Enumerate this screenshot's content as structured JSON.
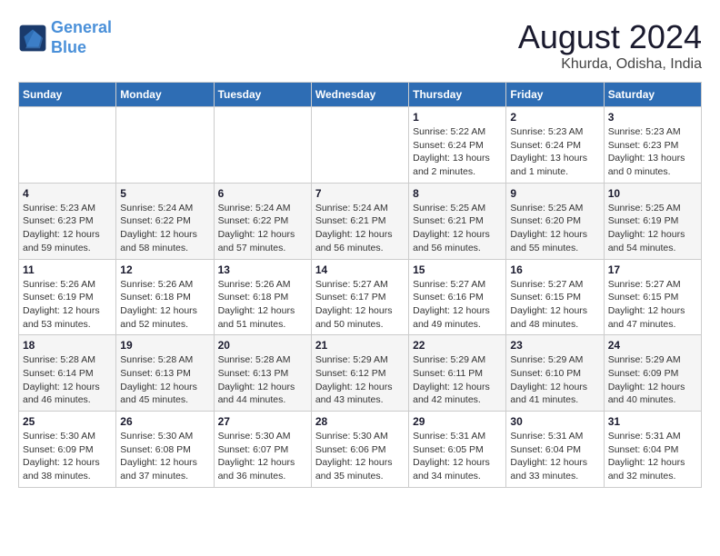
{
  "logo": {
    "line1": "General",
    "line2": "Blue"
  },
  "title": "August 2024",
  "subtitle": "Khurda, Odisha, India",
  "days_of_week": [
    "Sunday",
    "Monday",
    "Tuesday",
    "Wednesday",
    "Thursday",
    "Friday",
    "Saturday"
  ],
  "weeks": [
    [
      {
        "day": "",
        "info": ""
      },
      {
        "day": "",
        "info": ""
      },
      {
        "day": "",
        "info": ""
      },
      {
        "day": "",
        "info": ""
      },
      {
        "day": "1",
        "info": "Sunrise: 5:22 AM\nSunset: 6:24 PM\nDaylight: 13 hours\nand 2 minutes."
      },
      {
        "day": "2",
        "info": "Sunrise: 5:23 AM\nSunset: 6:24 PM\nDaylight: 13 hours\nand 1 minute."
      },
      {
        "day": "3",
        "info": "Sunrise: 5:23 AM\nSunset: 6:23 PM\nDaylight: 13 hours\nand 0 minutes."
      }
    ],
    [
      {
        "day": "4",
        "info": "Sunrise: 5:23 AM\nSunset: 6:23 PM\nDaylight: 12 hours\nand 59 minutes."
      },
      {
        "day": "5",
        "info": "Sunrise: 5:24 AM\nSunset: 6:22 PM\nDaylight: 12 hours\nand 58 minutes."
      },
      {
        "day": "6",
        "info": "Sunrise: 5:24 AM\nSunset: 6:22 PM\nDaylight: 12 hours\nand 57 minutes."
      },
      {
        "day": "7",
        "info": "Sunrise: 5:24 AM\nSunset: 6:21 PM\nDaylight: 12 hours\nand 56 minutes."
      },
      {
        "day": "8",
        "info": "Sunrise: 5:25 AM\nSunset: 6:21 PM\nDaylight: 12 hours\nand 56 minutes."
      },
      {
        "day": "9",
        "info": "Sunrise: 5:25 AM\nSunset: 6:20 PM\nDaylight: 12 hours\nand 55 minutes."
      },
      {
        "day": "10",
        "info": "Sunrise: 5:25 AM\nSunset: 6:19 PM\nDaylight: 12 hours\nand 54 minutes."
      }
    ],
    [
      {
        "day": "11",
        "info": "Sunrise: 5:26 AM\nSunset: 6:19 PM\nDaylight: 12 hours\nand 53 minutes."
      },
      {
        "day": "12",
        "info": "Sunrise: 5:26 AM\nSunset: 6:18 PM\nDaylight: 12 hours\nand 52 minutes."
      },
      {
        "day": "13",
        "info": "Sunrise: 5:26 AM\nSunset: 6:18 PM\nDaylight: 12 hours\nand 51 minutes."
      },
      {
        "day": "14",
        "info": "Sunrise: 5:27 AM\nSunset: 6:17 PM\nDaylight: 12 hours\nand 50 minutes."
      },
      {
        "day": "15",
        "info": "Sunrise: 5:27 AM\nSunset: 6:16 PM\nDaylight: 12 hours\nand 49 minutes."
      },
      {
        "day": "16",
        "info": "Sunrise: 5:27 AM\nSunset: 6:15 PM\nDaylight: 12 hours\nand 48 minutes."
      },
      {
        "day": "17",
        "info": "Sunrise: 5:27 AM\nSunset: 6:15 PM\nDaylight: 12 hours\nand 47 minutes."
      }
    ],
    [
      {
        "day": "18",
        "info": "Sunrise: 5:28 AM\nSunset: 6:14 PM\nDaylight: 12 hours\nand 46 minutes."
      },
      {
        "day": "19",
        "info": "Sunrise: 5:28 AM\nSunset: 6:13 PM\nDaylight: 12 hours\nand 45 minutes."
      },
      {
        "day": "20",
        "info": "Sunrise: 5:28 AM\nSunset: 6:13 PM\nDaylight: 12 hours\nand 44 minutes."
      },
      {
        "day": "21",
        "info": "Sunrise: 5:29 AM\nSunset: 6:12 PM\nDaylight: 12 hours\nand 43 minutes."
      },
      {
        "day": "22",
        "info": "Sunrise: 5:29 AM\nSunset: 6:11 PM\nDaylight: 12 hours\nand 42 minutes."
      },
      {
        "day": "23",
        "info": "Sunrise: 5:29 AM\nSunset: 6:10 PM\nDaylight: 12 hours\nand 41 minutes."
      },
      {
        "day": "24",
        "info": "Sunrise: 5:29 AM\nSunset: 6:09 PM\nDaylight: 12 hours\nand 40 minutes."
      }
    ],
    [
      {
        "day": "25",
        "info": "Sunrise: 5:30 AM\nSunset: 6:09 PM\nDaylight: 12 hours\nand 38 minutes."
      },
      {
        "day": "26",
        "info": "Sunrise: 5:30 AM\nSunset: 6:08 PM\nDaylight: 12 hours\nand 37 minutes."
      },
      {
        "day": "27",
        "info": "Sunrise: 5:30 AM\nSunset: 6:07 PM\nDaylight: 12 hours\nand 36 minutes."
      },
      {
        "day": "28",
        "info": "Sunrise: 5:30 AM\nSunset: 6:06 PM\nDaylight: 12 hours\nand 35 minutes."
      },
      {
        "day": "29",
        "info": "Sunrise: 5:31 AM\nSunset: 6:05 PM\nDaylight: 12 hours\nand 34 minutes."
      },
      {
        "day": "30",
        "info": "Sunrise: 5:31 AM\nSunset: 6:04 PM\nDaylight: 12 hours\nand 33 minutes."
      },
      {
        "day": "31",
        "info": "Sunrise: 5:31 AM\nSunset: 6:04 PM\nDaylight: 12 hours\nand 32 minutes."
      }
    ]
  ]
}
